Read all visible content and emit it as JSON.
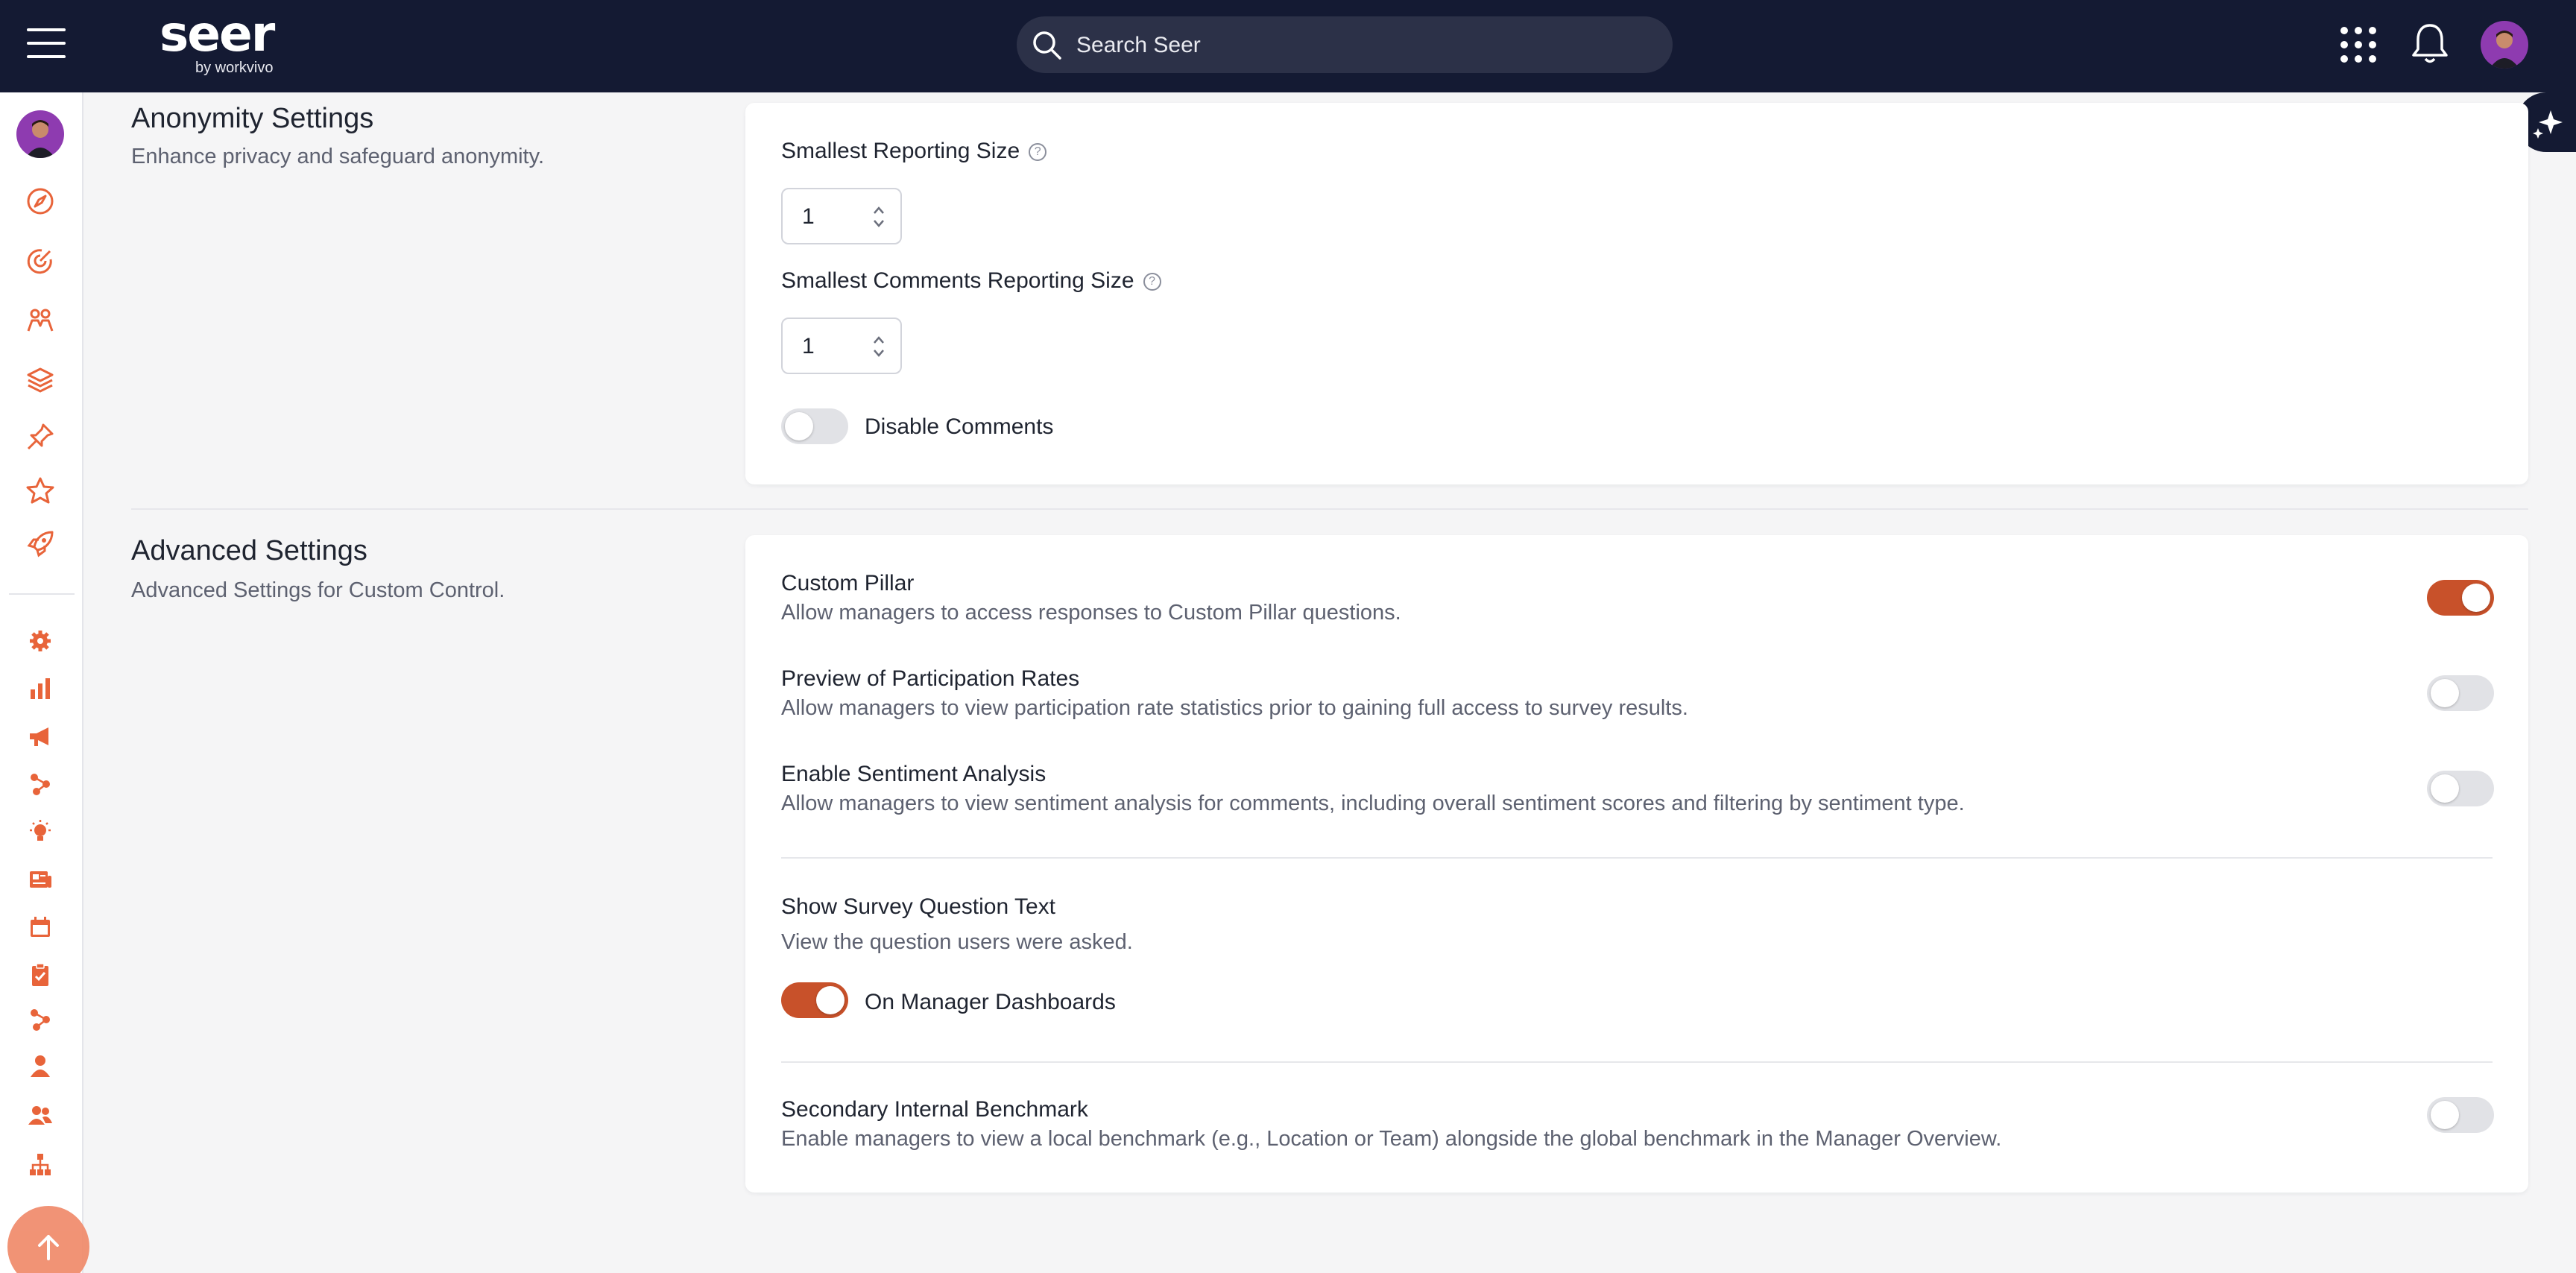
{
  "header": {
    "logo_word": "seer",
    "logo_by": "by workvivo",
    "search_placeholder": "Search Seer"
  },
  "colors": {
    "accent": "#c8512a",
    "nav_bg": "#141a33",
    "sidebar_icon": "#e8643a"
  },
  "sidebar": {
    "icons": [
      "compass-icon",
      "target-icon",
      "people-icon",
      "layers-icon",
      "pin-icon",
      "star-icon",
      "rocket-icon",
      "gear-icon",
      "bar-chart-icon",
      "megaphone-icon",
      "nodes-icon",
      "lightbulb-icon",
      "newspaper-icon",
      "calendar-icon",
      "clipboard-icon",
      "nodes-icon",
      "person-icon",
      "users-icon",
      "org-chart-icon"
    ]
  },
  "anonymity": {
    "title": "Anonymity Settings",
    "subtitle": "Enhance privacy and safeguard anonymity.",
    "smallest_reporting_label": "Smallest Reporting Size",
    "smallest_reporting_value": "1",
    "smallest_comments_label": "Smallest Comments Reporting Size",
    "smallest_comments_value": "1",
    "disable_comments_label": "Disable Comments",
    "disable_comments_on": false
  },
  "advanced": {
    "title": "Advanced Settings",
    "subtitle": "Advanced Settings for Custom Control.",
    "custom_pillar": {
      "label": "Custom Pillar",
      "desc": "Allow managers to access responses to Custom Pillar questions.",
      "on": true
    },
    "participation": {
      "label": "Preview of Participation Rates",
      "desc": "Allow managers to view participation rate statistics prior to gaining full access to survey results.",
      "on": false
    },
    "sentiment": {
      "label": "Enable Sentiment Analysis",
      "desc": "Allow managers to view sentiment analysis for comments, including overall sentiment scores and filtering by sentiment type.",
      "on": false
    },
    "survey_text": {
      "label": "Show Survey Question Text",
      "desc": "View the question users were asked.",
      "toggle_label": "On Manager Dashboards",
      "on": true
    },
    "benchmark": {
      "label": "Secondary Internal Benchmark",
      "desc": "Enable managers to view a local benchmark (e.g., Location or Team) alongside the global benchmark in the Manager Overview.",
      "on": false
    }
  }
}
